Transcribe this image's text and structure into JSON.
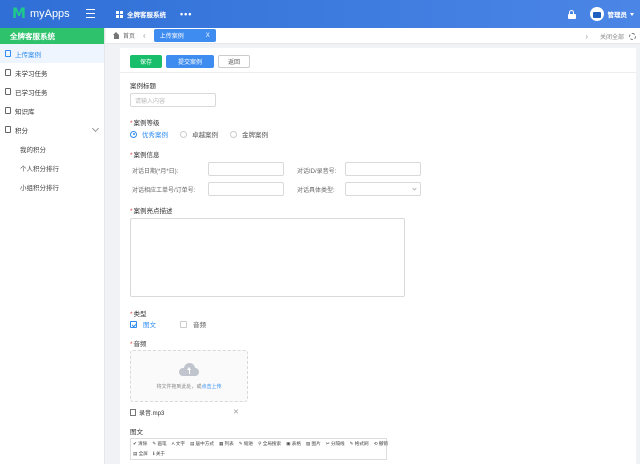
{
  "app": {
    "logo_mark": "M",
    "name": "myApps"
  },
  "topbar": {
    "system_menu": "全牌客服系统",
    "more": "•••",
    "user_name": "管理员"
  },
  "sidebar": {
    "header": "全牌客服系统",
    "items": [
      {
        "label": "上传案例",
        "active": true
      },
      {
        "label": "未学习任务"
      },
      {
        "label": "已学习任务"
      },
      {
        "label": "知识库"
      },
      {
        "label": "积分"
      }
    ],
    "sub_items": [
      {
        "label": "我的积分"
      },
      {
        "label": "个人积分排行"
      },
      {
        "label": "小组积分排行"
      }
    ]
  },
  "tabs": {
    "home": "首页",
    "prev": "‹",
    "active": "上传案例",
    "active_close": "X",
    "next": "›",
    "close_all": "关闭全部"
  },
  "toolbar": {
    "save": "保存",
    "submit": "提交案例",
    "back": "返回"
  },
  "form": {
    "title_label": "案例标题",
    "title_placeholder": "请输入内容",
    "level_label": "案例等级",
    "level_options": [
      "优秀案例",
      "卓越案例",
      "金牌案例"
    ],
    "level_selected": "优秀案例",
    "info_label": "案例信息",
    "date_label": "对话日期(*月*日):",
    "id_label": "对话ID/录音号:",
    "ticket_label": "对话相应工单号/订单号:",
    "type_label": "对话具体类型:",
    "desc_label": "案例亮点描述",
    "category_label": "类型",
    "category_options": [
      "图文",
      "音频"
    ],
    "category_checked": "图文",
    "audio_label": "音频",
    "upload_text": "将文件拖到此处，或",
    "upload_link": "点击上传",
    "file_name": "录音.mp3",
    "file_delete": "✕",
    "richtext_label": "图文"
  },
  "editor_toolbar": {
    "row1": [
      "✔ 清除",
      "✎ 画笔",
      "A 文字",
      "▤ 居中方式",
      "▦ 列表",
      "✎ 缩进",
      "⚲ 全局搜索",
      "▣ 表格",
      "▨ 图片",
      "✂ 分隔线",
      "✎ 格式刷",
      "⟲ 撤销"
    ],
    "row2": [
      "▤ 全屏",
      "ℹ 关于"
    ]
  },
  "colors": {
    "brand_green": "#2dc26b",
    "primary_blue": "#3f8cf0",
    "topbar_blue": "#2f6fd6",
    "required_red": "#e5403a"
  }
}
